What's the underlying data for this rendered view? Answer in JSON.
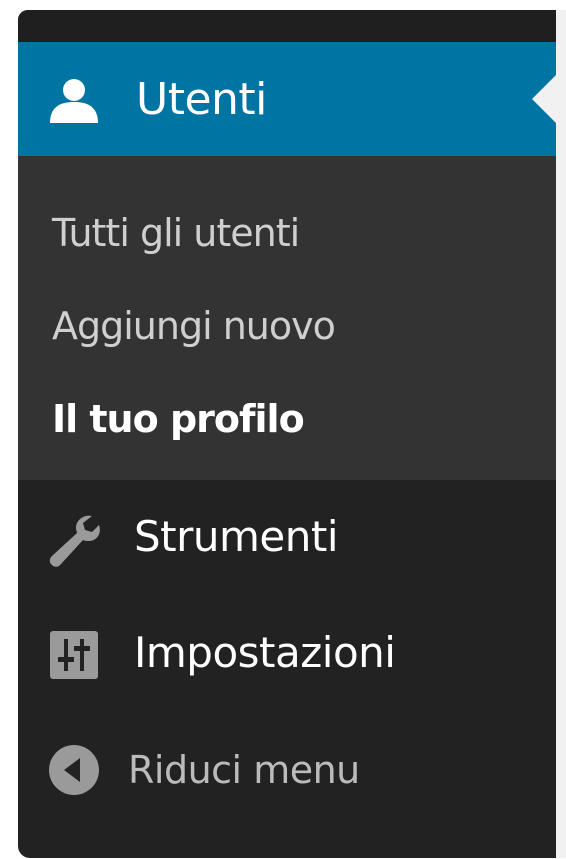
{
  "menu": {
    "active": {
      "label": "Utenti",
      "icon": "user-icon"
    },
    "submenu": [
      {
        "label": "Tutti gli utenti",
        "current": false
      },
      {
        "label": "Aggiungi nuovo",
        "current": false
      },
      {
        "label": "Il tuo profilo",
        "current": true
      }
    ],
    "items": [
      {
        "label": "Strumenti",
        "icon": "wrench-icon"
      },
      {
        "label": "Impostazioni",
        "icon": "settings-sliders-icon"
      }
    ],
    "collapse": {
      "label": "Riduci menu",
      "icon": "collapse-arrow-icon"
    }
  },
  "colors": {
    "menu_bg": "#222222",
    "submenu_bg": "#333333",
    "active_bg": "#0074a2",
    "text_white": "#ffffff",
    "text_muted": "#cfcfcf",
    "icon_gray": "#9a9a9a"
  }
}
